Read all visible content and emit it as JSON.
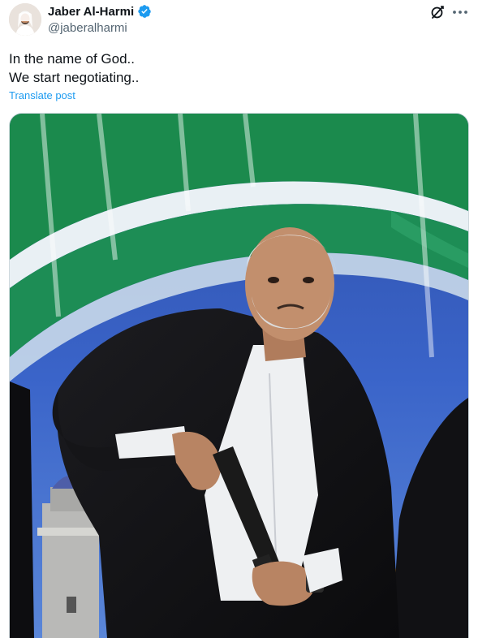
{
  "author": {
    "display_name": "Jaber Al-Harmi",
    "handle": "@jaberalharmi"
  },
  "post": {
    "lines": [
      "In the name of God..",
      "We start negotiating.."
    ],
    "translate_label": "Translate post"
  },
  "icons": {
    "verified": "verified-badge-icon",
    "grok": "grok-icon",
    "more": "more-options-icon"
  },
  "colors": {
    "link": "#1d9bf0",
    "secondary_text": "#536471",
    "primary_text": "#0f1419"
  }
}
